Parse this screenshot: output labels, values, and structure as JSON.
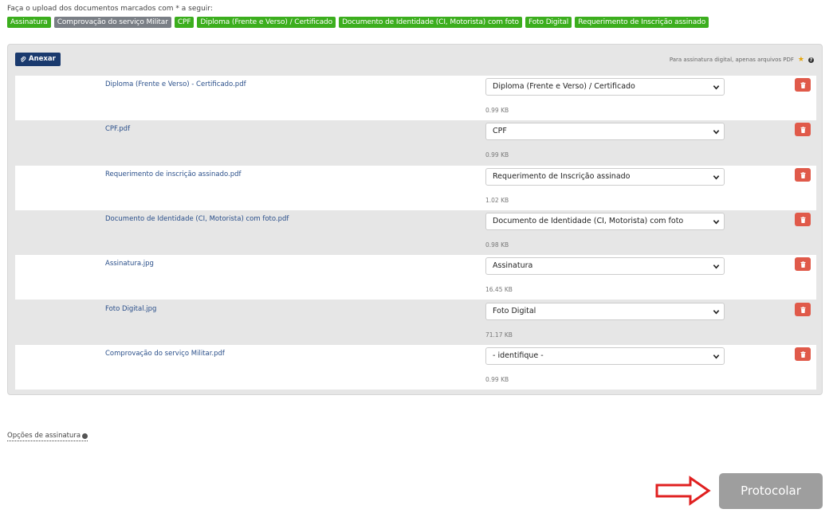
{
  "instruction": "Faça o upload dos documentos marcados com * a seguir:",
  "tags": [
    {
      "label": "Assinatura",
      "color": "#3cae1e"
    },
    {
      "label": "Comprovação do serviço Militar",
      "color": "#7a7f86"
    },
    {
      "label": "CPF",
      "color": "#3cae1e"
    },
    {
      "label": "Diploma (Frente e Verso) / Certificado",
      "color": "#3cae1e"
    },
    {
      "label": "Documento de Identidade (CI, Motorista) com foto",
      "color": "#3cae1e"
    },
    {
      "label": "Foto Digital",
      "color": "#3cae1e"
    },
    {
      "label": "Requerimento de Inscrição assinado",
      "color": "#3cae1e"
    }
  ],
  "panel": {
    "attach_label": "Anexar",
    "note": "Para assinatura digital, apenas arquivos PDF"
  },
  "files": [
    {
      "name": "Diploma (Frente e Verso) - Certificado.pdf",
      "type": "Diploma (Frente e Verso) / Certificado",
      "size": "0.99 KB"
    },
    {
      "name": "CPF.pdf",
      "type": "CPF",
      "size": "0.99 KB"
    },
    {
      "name": "Requerimento de inscrição assinado.pdf",
      "type": "Requerimento de Inscrição assinado",
      "size": "1.02 KB"
    },
    {
      "name": "Documento de Identidade (CI, Motorista) com foto.pdf",
      "type": "Documento de Identidade (CI, Motorista) com foto",
      "size": "0.98 KB"
    },
    {
      "name": "Assinatura.jpg",
      "type": "Assinatura",
      "size": "16.45 KB"
    },
    {
      "name": "Foto Digital.jpg",
      "type": "Foto Digital",
      "size": "71.17 KB"
    },
    {
      "name": "Comprovação do serviço Militar.pdf",
      "type": "- identifique -",
      "size": "0.99 KB"
    }
  ],
  "signature_options": "Opções de assinatura",
  "submit_label": "Protocolar",
  "colors": {
    "accent_green": "#3cae1e",
    "tag_gray": "#7a7f86",
    "navy": "#1a3a6e",
    "delete_red": "#e05a4a",
    "submit_gray": "#9e9e9e",
    "arrow_red": "#e02020"
  }
}
